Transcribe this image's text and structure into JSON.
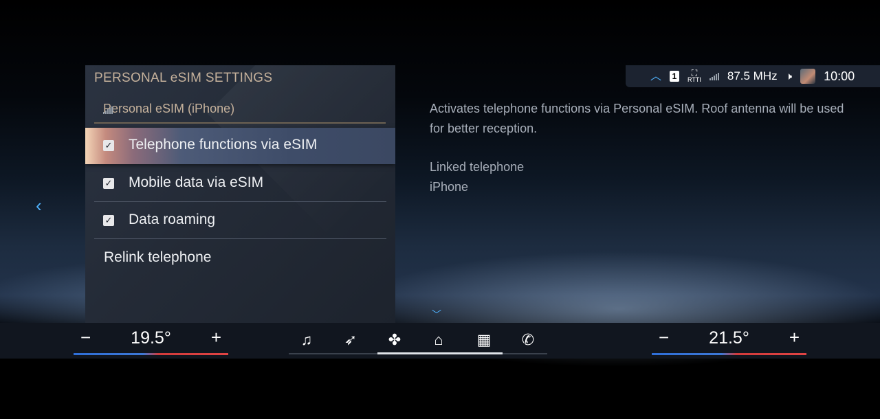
{
  "status_bar": {
    "expand_icon": "chevron-up-icon",
    "channel": "1",
    "rtti": "RTTI",
    "frequency": "87.5 MHz",
    "time": "10:00"
  },
  "panel": {
    "title": "PERSONAL eSIM SETTINGS",
    "subtitle": "Personal eSIM (iPhone)",
    "items": [
      {
        "label": "Telephone functions via eSIM",
        "checked": true,
        "selected": true
      },
      {
        "label": "Mobile data via eSIM",
        "checked": true,
        "selected": false
      },
      {
        "label": "Data roaming",
        "checked": true,
        "selected": false
      }
    ],
    "relink_label": "Relink telephone"
  },
  "info": {
    "description": "Activates telephone functions via Personal eSIM. Roof antenna will be used for better reception.",
    "linked_label": "Linked telephone",
    "linked_value": "iPhone"
  },
  "climate": {
    "left_temp": "19.5°",
    "right_temp": "21.5°",
    "minus": "−",
    "plus": "+"
  },
  "nav_icons": [
    "music-icon",
    "navigation-icon",
    "fan-icon",
    "home-icon",
    "apps-icon",
    "phone-icon"
  ],
  "colors": {
    "accent": "#4fb3ff",
    "heading": "#c6b29c"
  }
}
